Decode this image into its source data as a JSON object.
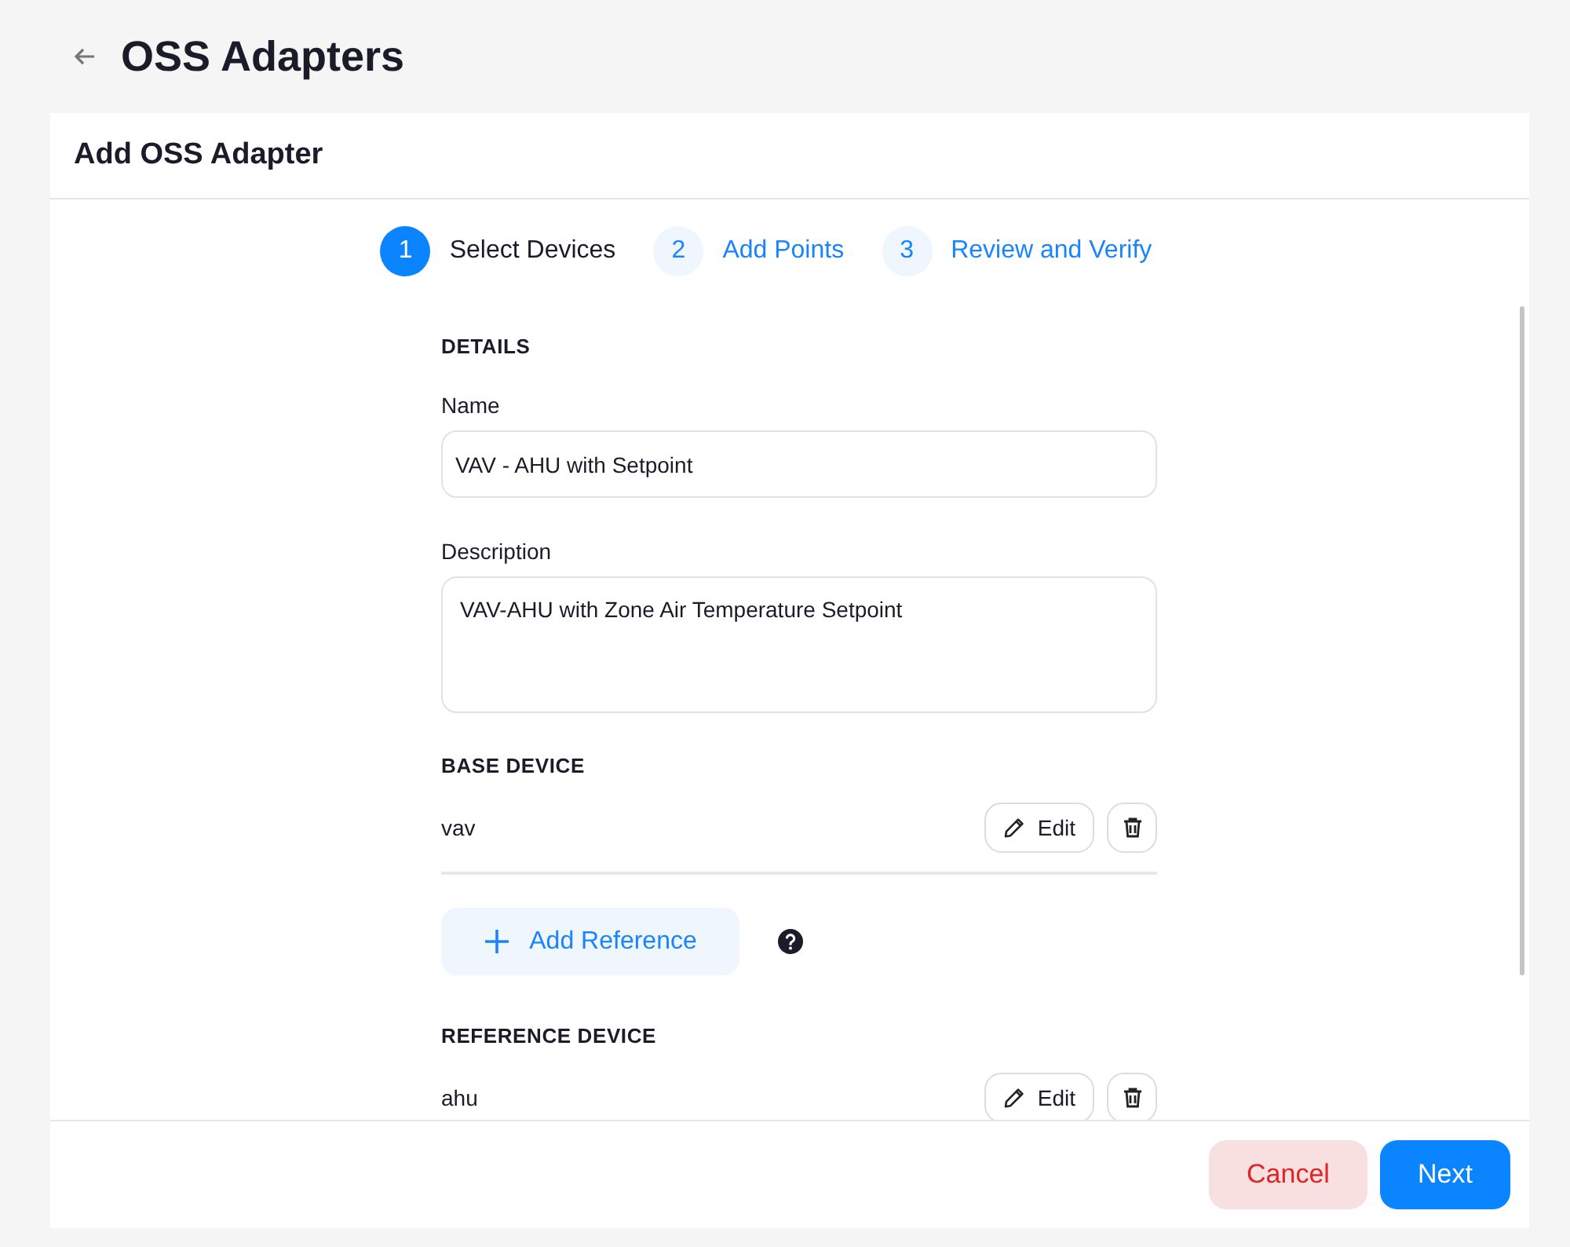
{
  "page": {
    "title": "OSS Adapters"
  },
  "card": {
    "title": "Add OSS Adapter"
  },
  "steps": [
    {
      "number": "1",
      "label": "Select Devices",
      "selected": true
    },
    {
      "number": "2",
      "label": "Add Points",
      "selected": false
    },
    {
      "number": "3",
      "label": "Review and Verify",
      "selected": false
    }
  ],
  "details": {
    "heading": "DETAILS",
    "fields": [
      {
        "kind": "text",
        "label": "Name",
        "value": "VAV - AHU with Setpoint"
      },
      {
        "kind": "textarea",
        "label": "Description",
        "value": "VAV-AHU with Zone Air Temperature Setpoint"
      }
    ]
  },
  "base_device": {
    "heading": "BASE DEVICE",
    "name": "vav",
    "edit_label": "Edit"
  },
  "add_reference": {
    "label": "Add Reference"
  },
  "reference_device": {
    "heading": "REFERENCE DEVICE",
    "name": "ahu",
    "edit_label": "Edit"
  },
  "buttons": [
    {
      "kind": "cancel",
      "label": "Cancel"
    },
    {
      "kind": "primary",
      "label": "Next"
    }
  ]
}
